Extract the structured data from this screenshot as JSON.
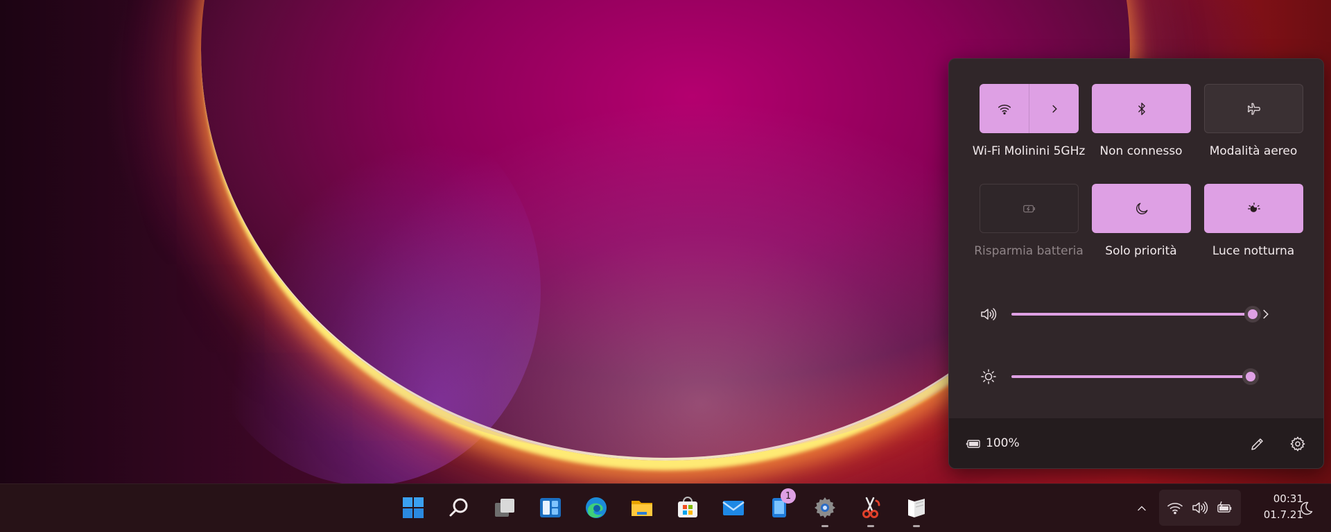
{
  "quick_settings": {
    "tiles": [
      {
        "label": "Wi-Fi Molinini 5GHz",
        "state": "on",
        "icon": "wifi-icon"
      },
      {
        "label": "Non connesso",
        "state": "on",
        "icon": "bluetooth-icon"
      },
      {
        "label": "Modalità aereo",
        "state": "off",
        "icon": "airplane-icon"
      },
      {
        "label": "Risparmia batteria",
        "state": "disabled",
        "icon": "battery-saver-icon"
      },
      {
        "label": "Solo priorità",
        "state": "on",
        "icon": "moon-icon"
      },
      {
        "label": "Luce notturna",
        "state": "on",
        "icon": "night-light-icon"
      }
    ],
    "volume": {
      "icon": "speaker-icon",
      "level": 1.0
    },
    "brightness": {
      "icon": "sun-icon",
      "level": 0.99
    },
    "footer": {
      "battery_text": "100%",
      "battery_icon": "battery-icon",
      "edit_icon": "pencil-icon",
      "settings_icon": "gear-icon"
    }
  },
  "taskbar": {
    "apps": [
      {
        "name": "start",
        "icon": "windows-logo-icon"
      },
      {
        "name": "search",
        "icon": "search-icon"
      },
      {
        "name": "task-view",
        "icon": "task-view-icon"
      },
      {
        "name": "widgets",
        "icon": "widgets-icon"
      },
      {
        "name": "edge",
        "icon": "edge-icon"
      },
      {
        "name": "file-explorer",
        "icon": "folder-icon"
      },
      {
        "name": "store",
        "icon": "store-icon"
      },
      {
        "name": "mail",
        "icon": "mail-icon"
      },
      {
        "name": "phone",
        "icon": "phone-icon",
        "badge": "1"
      },
      {
        "name": "settings",
        "icon": "gear-icon",
        "running": true
      },
      {
        "name": "snipping-tool",
        "icon": "scissors-icon",
        "running": true
      },
      {
        "name": "notes",
        "icon": "notes-icon",
        "running": true
      }
    ],
    "tray": {
      "clock_time": "00:31",
      "clock_date": "01.7.21"
    }
  },
  "colors": {
    "accent": "#dea0e4",
    "panel": "#302629",
    "panel_footer": "#241c1e"
  }
}
